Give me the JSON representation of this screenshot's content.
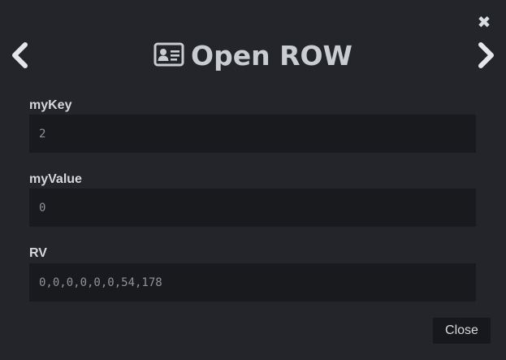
{
  "dialog": {
    "title": "Open ROW",
    "title_icon": "id-card-icon",
    "close_icon": "close-icon",
    "prev_icon": "chevron-left-icon",
    "next_icon": "chevron-right-icon"
  },
  "fields": [
    {
      "label": "myKey",
      "value": "2"
    },
    {
      "label": "myValue",
      "value": "0"
    },
    {
      "label": "RV",
      "value": "0,0,0,0,0,0,54,178"
    }
  ],
  "footer": {
    "close_label": "Close"
  },
  "colors": {
    "background": "#23252b",
    "field_background": "#191a1e",
    "text": "#c9ccd1"
  }
}
